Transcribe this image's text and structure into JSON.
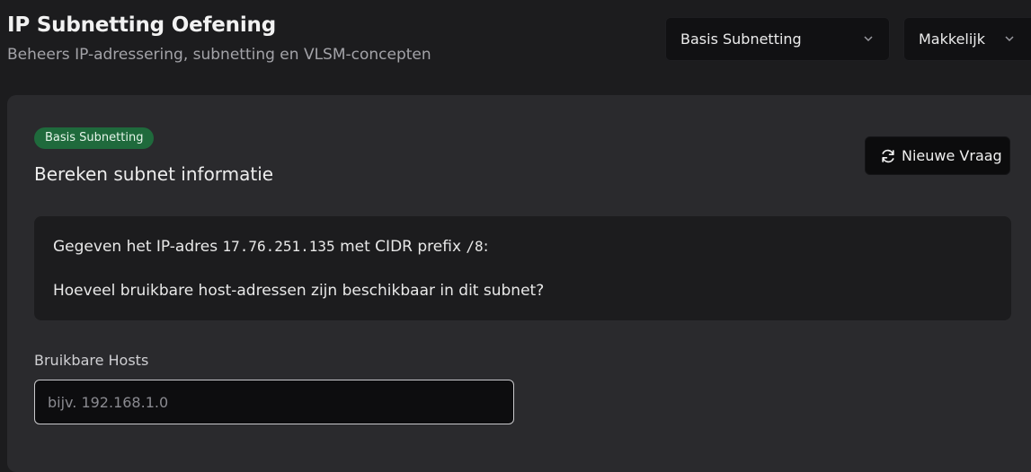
{
  "header": {
    "title": "IP Subnetting Oefening",
    "subtitle": "Beheers IP-adressering, subnetting en VLSM-concepten"
  },
  "selects": {
    "type_value": "Basis Subnetting",
    "difficulty_value": "Makkelijk",
    "chevron_icon": "chevron-down-icon"
  },
  "card": {
    "badge": "Basis Subnetting",
    "title": "Bereken subnet informatie",
    "new_question_label": "Nieuwe Vraag",
    "new_question_icon": "refresh-icon"
  },
  "question": {
    "prefix_text": "Gegeven het IP-adres ",
    "ip": "17.76.251.135",
    "middle_text": " met CIDR prefix ",
    "cidr": "/8",
    "suffix_text": ":",
    "prompt": "Hoeveel bruikbare host-adressen zijn beschikbaar in dit subnet?"
  },
  "answer": {
    "label": "Bruikbare Hosts",
    "placeholder": "bijv. 192.168.1.0",
    "value": ""
  },
  "colors": {
    "background": "#1c1c1e",
    "card": "#2a2a2d",
    "badge": "#1f6a3c",
    "button": "#0c0c0d"
  }
}
